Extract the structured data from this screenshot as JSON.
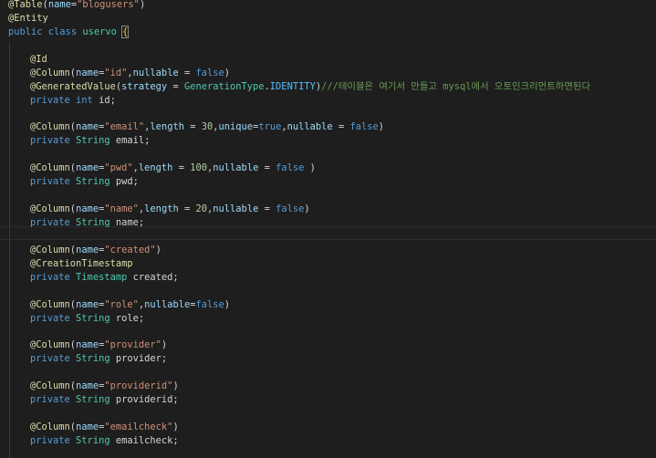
{
  "editor": {
    "lines": [
      {
        "tokens": [
          [
            "ann",
            "@Table"
          ],
          [
            "plain",
            "("
          ],
          [
            "par",
            "name"
          ],
          [
            "plain",
            "="
          ],
          [
            "str",
            "\"blogusers\""
          ],
          [
            "plain",
            ")"
          ]
        ]
      },
      {
        "tokens": [
          [
            "ann",
            "@Entity"
          ]
        ]
      },
      {
        "tokens": [
          [
            "kw",
            "public class "
          ],
          [
            "cls",
            "uservo"
          ],
          [
            "plain",
            " "
          ],
          [
            "brace",
            "{"
          ]
        ]
      },
      {
        "tokens": []
      },
      {
        "indent": true,
        "tokens": [
          [
            "ann",
            "@Id"
          ]
        ]
      },
      {
        "indent": true,
        "tokens": [
          [
            "ann",
            "@Column"
          ],
          [
            "plain",
            "("
          ],
          [
            "par",
            "name"
          ],
          [
            "plain",
            "="
          ],
          [
            "str",
            "\"id\""
          ],
          [
            "plain",
            ","
          ],
          [
            "par",
            "nullable"
          ],
          [
            "plain",
            " = "
          ],
          [
            "bool",
            "false"
          ],
          [
            "plain",
            ")"
          ]
        ]
      },
      {
        "indent": true,
        "tokens": [
          [
            "ann",
            "@GeneratedValue"
          ],
          [
            "plain",
            "("
          ],
          [
            "par",
            "strategy"
          ],
          [
            "plain",
            " = "
          ],
          [
            "type",
            "GenerationType"
          ],
          [
            "plain",
            "."
          ],
          [
            "enum",
            "IDENTITY"
          ],
          [
            "plain",
            ")"
          ],
          [
            "cmt",
            "///테이블은 여기서 만들고 mysql에서 오토인크리먼트하면된다"
          ]
        ]
      },
      {
        "indent": true,
        "tokens": [
          [
            "kw",
            "private "
          ],
          [
            "kw",
            "int "
          ],
          [
            "plain",
            "id;"
          ]
        ]
      },
      {
        "tokens": []
      },
      {
        "indent": true,
        "tokens": [
          [
            "ann",
            "@Column"
          ],
          [
            "plain",
            "("
          ],
          [
            "par",
            "name"
          ],
          [
            "plain",
            "="
          ],
          [
            "str",
            "\"email\""
          ],
          [
            "plain",
            ","
          ],
          [
            "par",
            "length"
          ],
          [
            "plain",
            " = "
          ],
          [
            "num",
            "30"
          ],
          [
            "plain",
            ","
          ],
          [
            "par",
            "unique"
          ],
          [
            "plain",
            "="
          ],
          [
            "bool",
            "true"
          ],
          [
            "plain",
            ","
          ],
          [
            "par",
            "nullable"
          ],
          [
            "plain",
            " = "
          ],
          [
            "bool",
            "false"
          ],
          [
            "plain",
            ")"
          ]
        ]
      },
      {
        "indent": true,
        "tokens": [
          [
            "kw",
            "private "
          ],
          [
            "type",
            "String "
          ],
          [
            "plain",
            "email;"
          ]
        ]
      },
      {
        "tokens": []
      },
      {
        "indent": true,
        "tokens": [
          [
            "ann",
            "@Column"
          ],
          [
            "plain",
            "("
          ],
          [
            "par",
            "name"
          ],
          [
            "plain",
            "="
          ],
          [
            "str",
            "\"pwd\""
          ],
          [
            "plain",
            ","
          ],
          [
            "par",
            "length"
          ],
          [
            "plain",
            " = "
          ],
          [
            "num",
            "100"
          ],
          [
            "plain",
            ","
          ],
          [
            "par",
            "nullable"
          ],
          [
            "plain",
            " = "
          ],
          [
            "bool",
            "false"
          ],
          [
            "plain",
            " )"
          ]
        ]
      },
      {
        "indent": true,
        "tokens": [
          [
            "kw",
            "private "
          ],
          [
            "type",
            "String "
          ],
          [
            "plain",
            "pwd;"
          ]
        ]
      },
      {
        "tokens": []
      },
      {
        "indent": true,
        "tokens": [
          [
            "ann",
            "@Column"
          ],
          [
            "plain",
            "("
          ],
          [
            "par",
            "name"
          ],
          [
            "plain",
            "="
          ],
          [
            "str",
            "\"name\""
          ],
          [
            "plain",
            ","
          ],
          [
            "par",
            "length"
          ],
          [
            "plain",
            " = "
          ],
          [
            "num",
            "20"
          ],
          [
            "plain",
            ","
          ],
          [
            "par",
            "nullable"
          ],
          [
            "plain",
            " = "
          ],
          [
            "bool",
            "false"
          ],
          [
            "plain",
            ")"
          ]
        ]
      },
      {
        "indent": true,
        "tokens": [
          [
            "kw",
            "private "
          ],
          [
            "type",
            "String "
          ],
          [
            "plain",
            "name;"
          ]
        ]
      },
      {
        "tokens": []
      },
      {
        "indent": true,
        "tokens": [
          [
            "ann",
            "@Column"
          ],
          [
            "plain",
            "("
          ],
          [
            "par",
            "name"
          ],
          [
            "plain",
            "="
          ],
          [
            "str",
            "\"created\""
          ],
          [
            "plain",
            ")"
          ]
        ]
      },
      {
        "indent": true,
        "tokens": [
          [
            "ann",
            "@CreationTimestamp"
          ]
        ]
      },
      {
        "indent": true,
        "tokens": [
          [
            "kw",
            "private "
          ],
          [
            "type",
            "Timestamp "
          ],
          [
            "plain",
            "created;"
          ]
        ]
      },
      {
        "tokens": []
      },
      {
        "indent": true,
        "tokens": [
          [
            "ann",
            "@Column"
          ],
          [
            "plain",
            "("
          ],
          [
            "par",
            "name"
          ],
          [
            "plain",
            "="
          ],
          [
            "str",
            "\"role\""
          ],
          [
            "plain",
            ","
          ],
          [
            "par",
            "nullable"
          ],
          [
            "plain",
            "="
          ],
          [
            "bool",
            "false"
          ],
          [
            "plain",
            ")"
          ]
        ]
      },
      {
        "indent": true,
        "tokens": [
          [
            "kw",
            "private "
          ],
          [
            "type",
            "String "
          ],
          [
            "plain",
            "role;"
          ]
        ]
      },
      {
        "tokens": []
      },
      {
        "indent": true,
        "tokens": [
          [
            "ann",
            "@Column"
          ],
          [
            "plain",
            "("
          ],
          [
            "par",
            "name"
          ],
          [
            "plain",
            "="
          ],
          [
            "str",
            "\"provider\""
          ],
          [
            "plain",
            ")"
          ]
        ]
      },
      {
        "indent": true,
        "tokens": [
          [
            "kw",
            "private "
          ],
          [
            "type",
            "String "
          ],
          [
            "plain",
            "provider;"
          ]
        ]
      },
      {
        "tokens": []
      },
      {
        "indent": true,
        "tokens": [
          [
            "ann",
            "@Column"
          ],
          [
            "plain",
            "("
          ],
          [
            "par",
            "name"
          ],
          [
            "plain",
            "="
          ],
          [
            "str",
            "\"providerid\""
          ],
          [
            "plain",
            ")"
          ]
        ]
      },
      {
        "indent": true,
        "tokens": [
          [
            "kw",
            "private "
          ],
          [
            "type",
            "String "
          ],
          [
            "plain",
            "providerid;"
          ]
        ]
      },
      {
        "tokens": []
      },
      {
        "indent": true,
        "tokens": [
          [
            "ann",
            "@Column"
          ],
          [
            "plain",
            "("
          ],
          [
            "par",
            "name"
          ],
          [
            "plain",
            "="
          ],
          [
            "str",
            "\"emailcheck\""
          ],
          [
            "plain",
            ")"
          ]
        ]
      },
      {
        "indent": true,
        "tokens": [
          [
            "kw",
            "private "
          ],
          [
            "type",
            "String "
          ],
          [
            "plain",
            "emailcheck;"
          ]
        ]
      }
    ]
  }
}
